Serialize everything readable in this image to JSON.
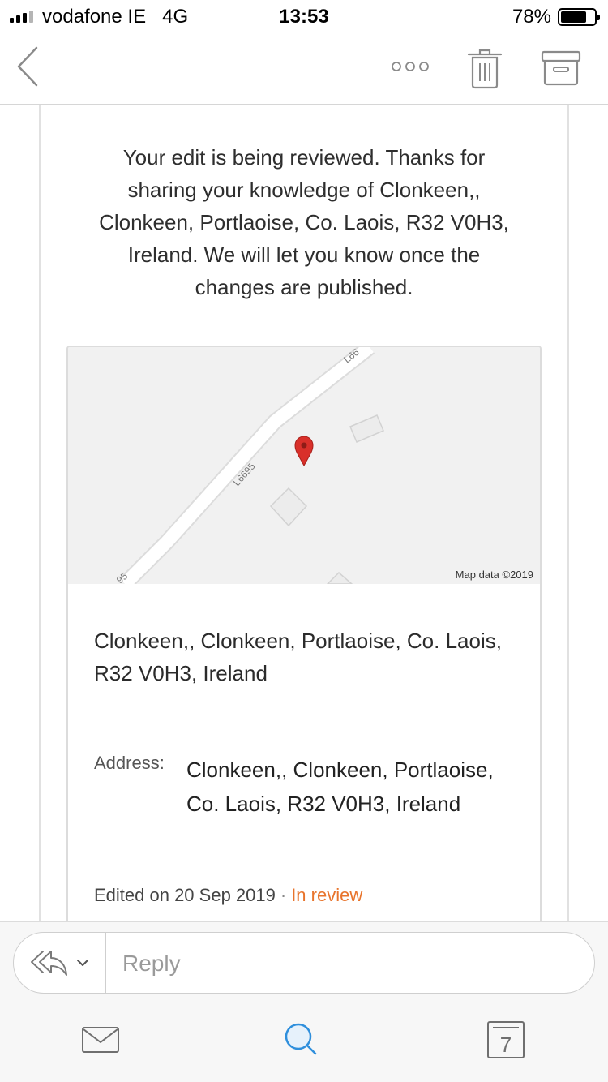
{
  "status_bar": {
    "carrier": "vodafone IE",
    "network": "4G",
    "time": "13:53",
    "battery_percent": "78%",
    "battery_level": 0.78,
    "signal_bars": 3,
    "signal_total": 4
  },
  "toolbar": {
    "back_icon": "chevron-left-icon",
    "more_icon": "more-horizontal-icon",
    "trash_icon": "trash-icon",
    "archive_icon": "archive-icon"
  },
  "message": {
    "intro_text": "Your edit is being reviewed. Thanks for sharing your knowledge of Clonkeen,, Clonkeen, Portlaoise, Co. Laois, R32 V0H3, Ireland. We will let you know once the changes are published.",
    "map": {
      "credit": "Map data ©2019",
      "road_label": "L6695",
      "road_label_top": "L66",
      "road_label_bottom": "95",
      "marker_color": "#d9302a"
    },
    "place_name": "Clonkeen,, Clonkeen, Portlaoise, Co. Laois, R32 V0H3, Ireland",
    "address_label": "Address:",
    "address_value": "Clonkeen,, Clonkeen, Portlaoise, Co. Laois, R32 V0H3, Ireland",
    "edited_text": "Edited on 20 Sep 2019",
    "separator": "·",
    "status": "In review",
    "status_color": "#e8742c"
  },
  "reply": {
    "placeholder": "Reply",
    "reply_icon": "reply-all-icon",
    "dropdown_icon": "chevron-down-icon"
  },
  "tab_bar": {
    "mail_icon": "mail-icon",
    "search_icon": "search-icon",
    "calendar_icon": "calendar-icon",
    "calendar_day": "7",
    "accent_color": "#2f8fdc"
  }
}
